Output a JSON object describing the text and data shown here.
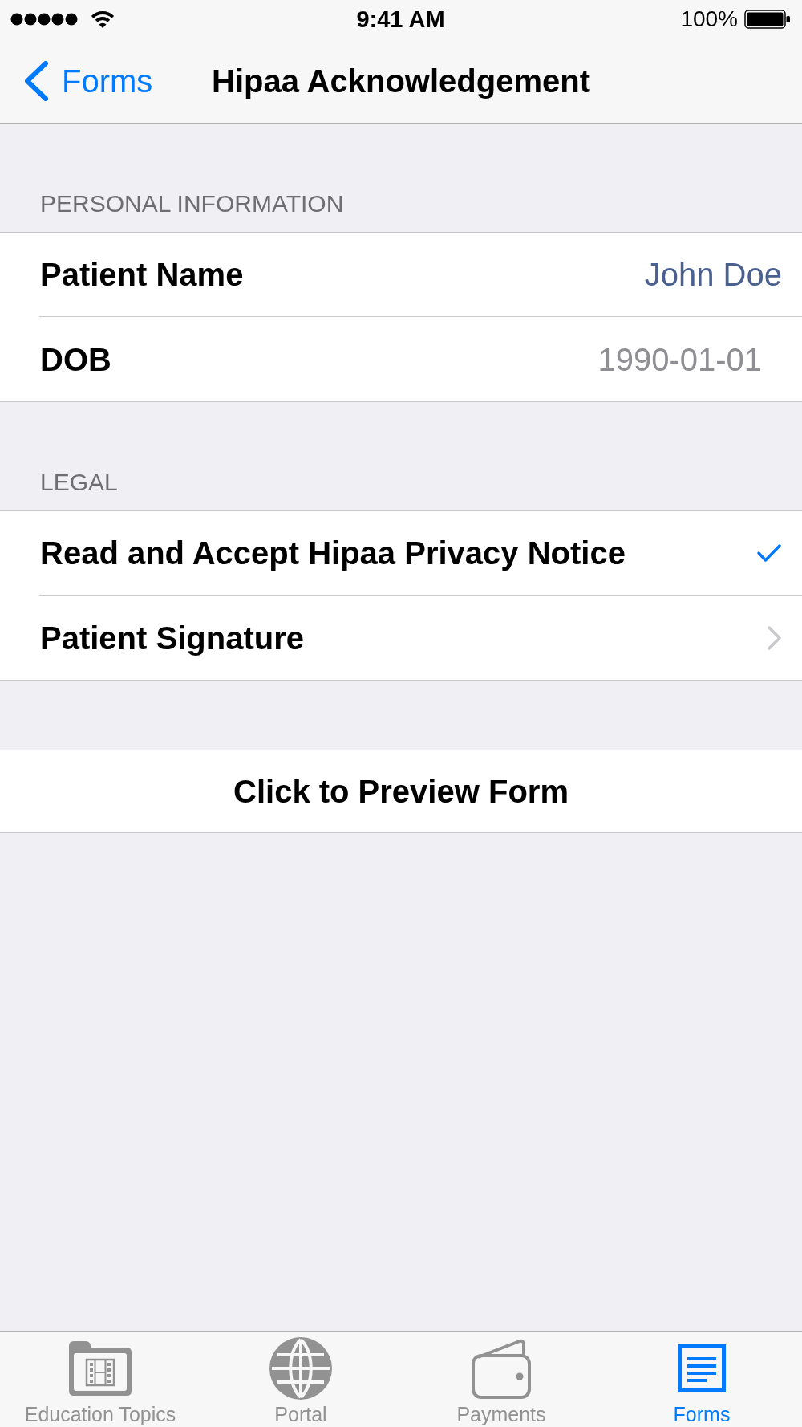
{
  "status_bar": {
    "time": "9:41 AM",
    "battery": "100%"
  },
  "nav_bar": {
    "back_label": "Forms",
    "title": "Hipaa Acknowledgement"
  },
  "sections": [
    {
      "header": "PERSONAL INFORMATION",
      "rows": [
        {
          "kind": "text",
          "label": "Patient Name",
          "value": "John Doe"
        },
        {
          "kind": "date",
          "label": "DOB",
          "value": "1990-01-01"
        }
      ]
    },
    {
      "header": "LEGAL",
      "rows": [
        {
          "kind": "check",
          "label": "Read and Accept Hipaa Privacy Notice",
          "checked": true
        },
        {
          "kind": "link",
          "label": "Patient Signature"
        }
      ]
    }
  ],
  "preview_button": "Click to Preview Form",
  "tabs": [
    {
      "label": "Education Topics",
      "selected": false
    },
    {
      "label": "Portal",
      "selected": false
    },
    {
      "label": "Payments",
      "selected": false
    },
    {
      "label": "Forms",
      "selected": true
    }
  ]
}
